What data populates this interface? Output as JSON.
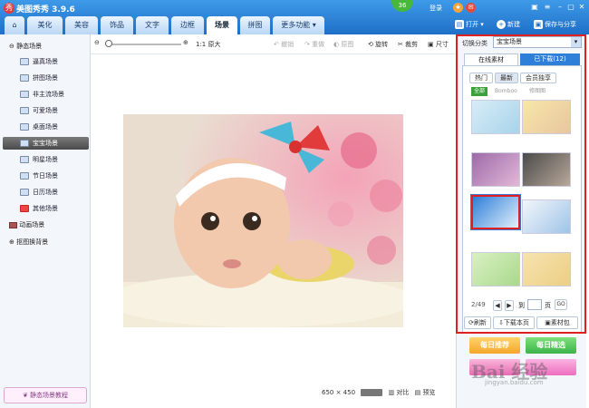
{
  "app": {
    "title": "美图秀秀 3.9.6",
    "badge": "36",
    "login": "登录"
  },
  "tabs": [
    {
      "label": "美化"
    },
    {
      "label": "美容"
    },
    {
      "label": "饰品"
    },
    {
      "label": "文字"
    },
    {
      "label": "边框"
    },
    {
      "label": "场景",
      "active": true
    },
    {
      "label": "拼图"
    },
    {
      "label": "更多功能 ▾"
    }
  ],
  "header_buttons": {
    "open": "打开",
    "new": "新建",
    "save_share": "保存与分享"
  },
  "sidebar": {
    "static_group": "静态场景",
    "items": [
      {
        "label": "逼真场景",
        "icon": "scene-icon"
      },
      {
        "label": "拼图场景",
        "icon": "puzzle-icon"
      },
      {
        "label": "非主流场景",
        "icon": "alt-icon"
      },
      {
        "label": "可爱场景",
        "icon": "cute-icon"
      },
      {
        "label": "桌面场景",
        "icon": "desktop-icon"
      },
      {
        "label": "宝宝场景",
        "icon": "baby-icon",
        "selected": true
      },
      {
        "label": "明星场景",
        "icon": "star-icon"
      },
      {
        "label": "节日场景",
        "icon": "festival-icon"
      },
      {
        "label": "日历场景",
        "icon": "calendar-icon"
      },
      {
        "label": "其他场景",
        "icon": "heart-icon"
      }
    ],
    "animated": "动画场景",
    "cutout": "抠图换背景",
    "tutorial": "静态场景教程"
  },
  "toolbar": {
    "original_size": "原大",
    "undo": "撤销",
    "redo": "重做",
    "original": "原图",
    "rotate": "旋转",
    "crop": "裁剪",
    "size": "尺寸"
  },
  "statusbar": {
    "dimensions": "650 × 450",
    "compare": "对比",
    "preview": "预览"
  },
  "right": {
    "category_label": "切换分类",
    "category_value": "宝宝场景",
    "tab_online": "在线素材",
    "tab_downloaded": "已下载(12)",
    "filters": [
      "热门",
      "最新",
      "会员独享"
    ],
    "subfilters": [
      "全部",
      "Bomboo",
      "修图图"
    ],
    "pager": {
      "page": "2/49",
      "of_label": "到",
      "page_label": "页",
      "go": "GO"
    },
    "actions": {
      "refresh": "刷新",
      "download_page": "下载本页",
      "pack": "素材包"
    },
    "promo": {
      "daily_hot": "每日推荐",
      "daily_pick": "每日精选"
    }
  },
  "watermark": {
    "text": "Bai 经验",
    "url": "jingyan.baidu.com"
  },
  "colors": {
    "accent": "#1f6fc7",
    "highlight": "#e02020"
  }
}
